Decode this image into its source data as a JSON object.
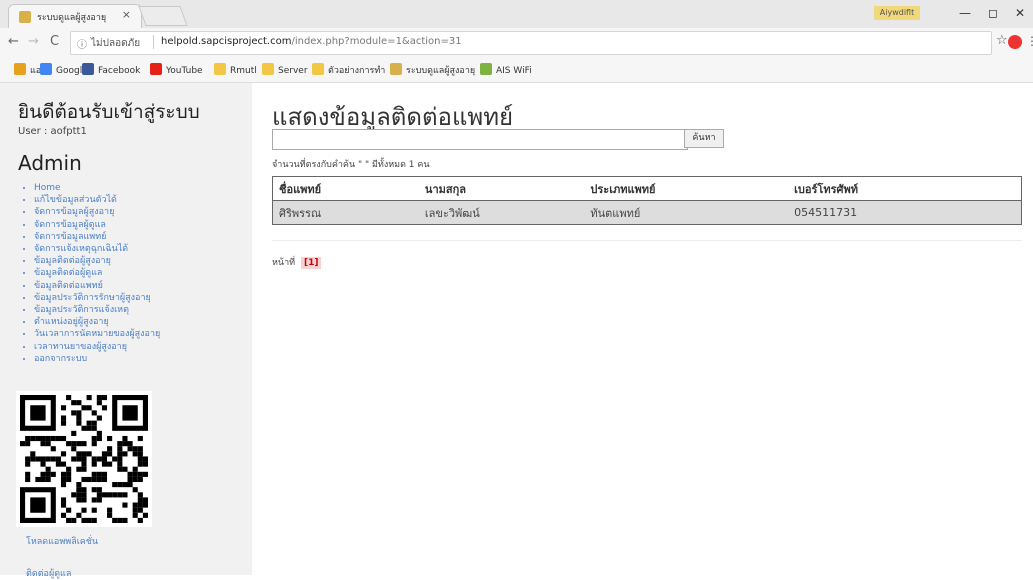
{
  "browser": {
    "tab_title": "ระบบดูแลผู้สูงอายุ",
    "tab_close": "×",
    "account": "Aiywdiflt",
    "controls": {
      "minimize": "—",
      "maximize": "◻",
      "close": "✕"
    },
    "address": {
      "security": "ไม่ปลอดภัย",
      "host": "helpold.sapcisproject.com",
      "path": "/index.php?module=1&action=31"
    },
    "bookmarks": [
      {
        "label": "แอป",
        "color": "#e8a11b"
      },
      {
        "label": "Google",
        "color": "#4285f4"
      },
      {
        "label": "Facebook",
        "color": "#3b5998"
      },
      {
        "label": "YouTube",
        "color": "#e62117"
      },
      {
        "label": "Rmutl",
        "color": "#f2c744"
      },
      {
        "label": "Server",
        "color": "#f2c744"
      },
      {
        "label": "ตัวอย่างการทำ",
        "color": "#f2c744"
      },
      {
        "label": "ระบบดูแลผู้สูงอายุ",
        "color": "#d8b04a"
      },
      {
        "label": "AIS WiFi",
        "color": "#7cb342"
      }
    ]
  },
  "sidebar": {
    "welcome": "ยินดีต้อนรับเข้าสู่ระบบ",
    "user": "User : aofptt1",
    "role": "Admin",
    "menu": [
      "Home",
      "แก้ไขข้อมูลส่วนตัวได้",
      "จัดการข้อมูลผู้สูงอายุ",
      "จัดการข้อมูลผู้ดูแล",
      "จัดการข้อมูลแพทย์",
      "จัดการแจ้งเหตุฉุกเฉินได้",
      "ข้อมูลติดต่อผู้สูงอายุ",
      "ข้อมูลติดต่อผู้ดูแล",
      "ข้อมูลติดต่อแพทย์",
      "ข้อมูลประวัติการรักษาผู้สูงอายุ",
      "ข้อมูลประวัติการแจ้งเหตุ",
      "ตำแหน่งอยู่ผู้สูงอายุ",
      "วันเวลาการนัดหมายของผู้สูงอายุ",
      "เวลาทานยาของผู้สูงอายุ",
      "ออกจากระบบ"
    ],
    "download_app": "โหลดแอพพลิเคชั่น",
    "contact_caregiver": "ติดต่อผู้ดูแล"
  },
  "main": {
    "title": "แสดงข้อมูลติดต่อแพทย์",
    "search_value": "",
    "search_button": "ค้นหา",
    "result_count": "จำนวนที่ตรงกับคำค้น \" \" มีทั้งหมด 1 คน",
    "table": {
      "headers": [
        "ชื่อแพทย์",
        "นามสกุล",
        "ประเภทแพทย์",
        "เบอร์โทรศัพท์"
      ],
      "rows": [
        [
          "ศิริพรรณ",
          "เลขะวิพัฒน์",
          "ทันตแพทย์",
          "054511731"
        ]
      ]
    },
    "pager": {
      "label": "หน้าที่",
      "current": "[1]"
    }
  }
}
